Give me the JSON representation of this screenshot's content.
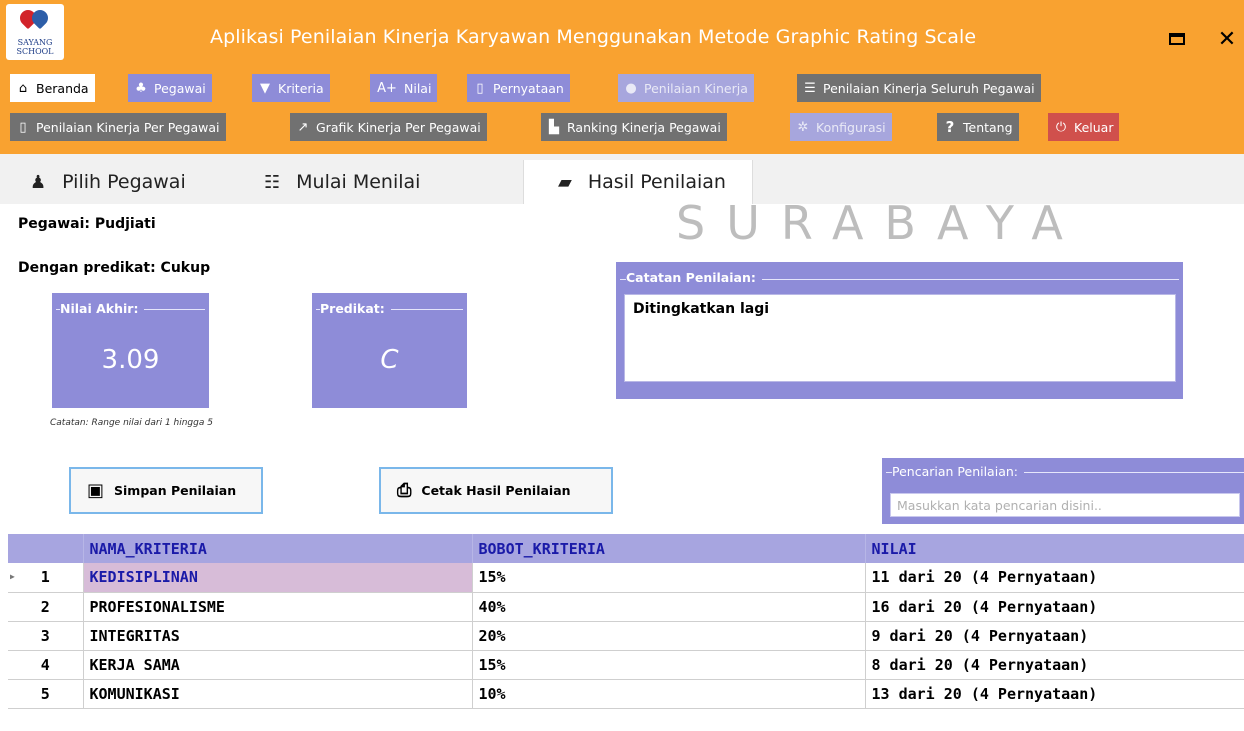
{
  "window": {
    "title": "Aplikasi Penilaian Kinerja Karyawan Menggunakan Metode Graphic Rating Scale",
    "logo_text": "SAYANG SCHOOL"
  },
  "menu": {
    "row1": [
      {
        "label": "Beranda",
        "icon": "home-icon"
      },
      {
        "label": "Pegawai",
        "icon": "users-icon"
      },
      {
        "label": "Kriteria",
        "icon": "filter-icon"
      },
      {
        "label": "Nilai",
        "icon": "grade-icon"
      },
      {
        "label": "Pernyataan",
        "icon": "document-icon"
      },
      {
        "label": "Penilaian Kinerja",
        "icon": "user-icon"
      },
      {
        "label": "Penilaian Kinerja Seluruh Pegawai",
        "icon": "list-icon"
      }
    ],
    "row2": [
      {
        "label": "Penilaian Kinerja Per Pegawai",
        "icon": "document-icon"
      },
      {
        "label": "Grafik Kinerja Per Pegawai",
        "icon": "chart-icon"
      },
      {
        "label": "Ranking Kinerja Pegawai",
        "icon": "ranking-icon"
      },
      {
        "label": "Konfigurasi",
        "icon": "gear-icon"
      },
      {
        "label": "Tentang",
        "icon": "question-icon"
      },
      {
        "label": "Keluar",
        "icon": "power-icon"
      }
    ]
  },
  "tabs": [
    {
      "label": "Pilih Pegawai",
      "icon": "person-icon"
    },
    {
      "label": "Mulai Menilai",
      "icon": "checklist-icon"
    },
    {
      "label": "Hasil Penilaian",
      "icon": "wallet-icon",
      "active": true
    }
  ],
  "watermark": "SURABAYA",
  "result": {
    "pegawai": "Pegawai: Pudjiati",
    "predikat_text": "Dengan predikat: Cukup",
    "nilai_akhir_label": "Nilai Akhir:",
    "nilai_akhir": "3.09",
    "predikat_label": "Predikat:",
    "predikat": "C",
    "note": "Catatan: Range nilai dari 1 hingga 5",
    "catatan_label": "Catatan Penilaian:",
    "catatan": "Ditingkatkan lagi"
  },
  "buttons": {
    "simpan": "Simpan Penilaian",
    "cetak": "Cetak Hasil Penilaian"
  },
  "search": {
    "label": "Pencarian Penilaian:",
    "placeholder": "Masukkan kata pencarian disini.."
  },
  "table": {
    "columns": [
      "NAMA_KRITERIA",
      "BOBOT_KRITERIA",
      "NILAI"
    ],
    "rows": [
      {
        "no": "1",
        "nama": "KEDISIPLINAN",
        "bobot": "15%",
        "nilai": "11 dari 20 (4 Pernyataan)"
      },
      {
        "no": "2",
        "nama": "PROFESIONALISME",
        "bobot": "40%",
        "nilai": "16 dari 20 (4 Pernyataan)"
      },
      {
        "no": "3",
        "nama": "INTEGRITAS",
        "bobot": "20%",
        "nilai": "9 dari 20 (4 Pernyataan)"
      },
      {
        "no": "4",
        "nama": "KERJA SAMA",
        "bobot": "15%",
        "nilai": "8 dari 20 (4 Pernyataan)"
      },
      {
        "no": "5",
        "nama": "KOMUNIKASI",
        "bobot": "10%",
        "nilai": "13 dari 20 (4 Pernyataan)"
      }
    ]
  },
  "colors": {
    "titlebar": "#f9a230",
    "accent_purple": "#8e8cd8",
    "header_text": "#1a1aa8",
    "selected_row": "#d7bcd8",
    "keluar": "#d0504c"
  }
}
